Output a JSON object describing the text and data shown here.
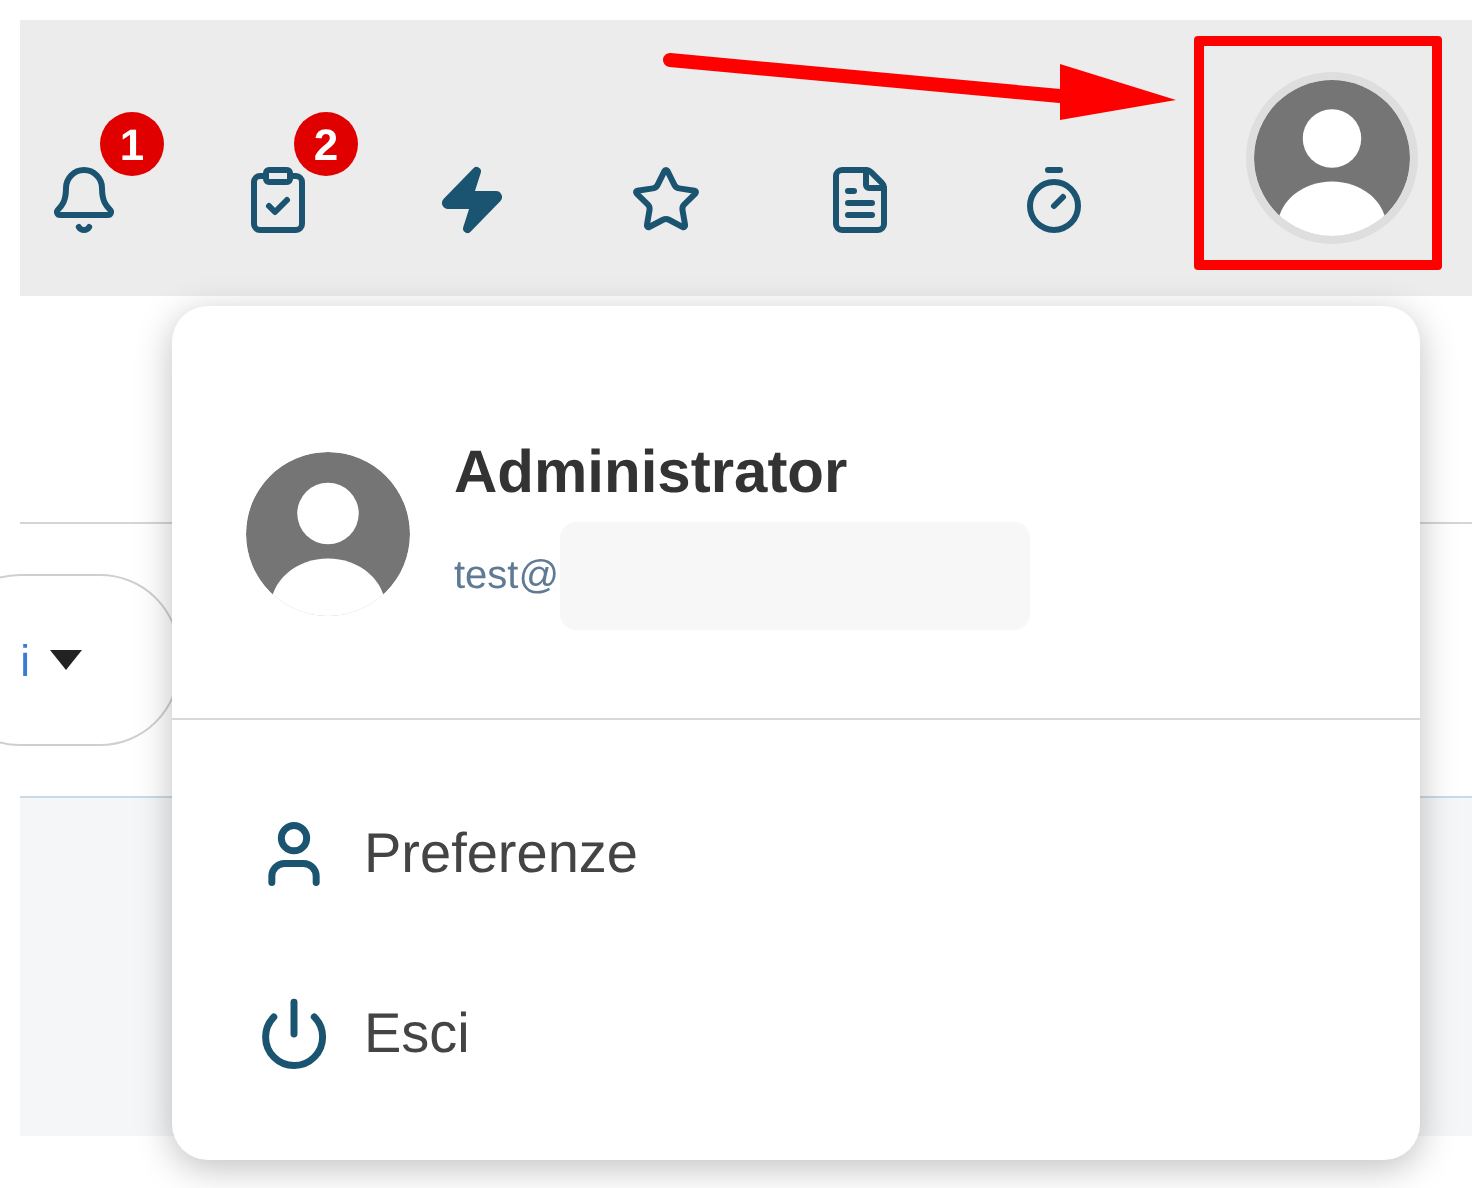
{
  "toolbar": {
    "items": [
      {
        "kind": "bell",
        "badge": "1"
      },
      {
        "kind": "clipboard",
        "badge": "2"
      },
      {
        "kind": "bolt"
      },
      {
        "kind": "star"
      },
      {
        "kind": "document"
      },
      {
        "kind": "timer"
      }
    ]
  },
  "background_select": {
    "value": "i"
  },
  "user_menu": {
    "name": "Administrator",
    "email": "test@",
    "items": [
      {
        "kind": "person",
        "label": "Preferenze"
      },
      {
        "kind": "power",
        "label": "Esci"
      }
    ]
  }
}
